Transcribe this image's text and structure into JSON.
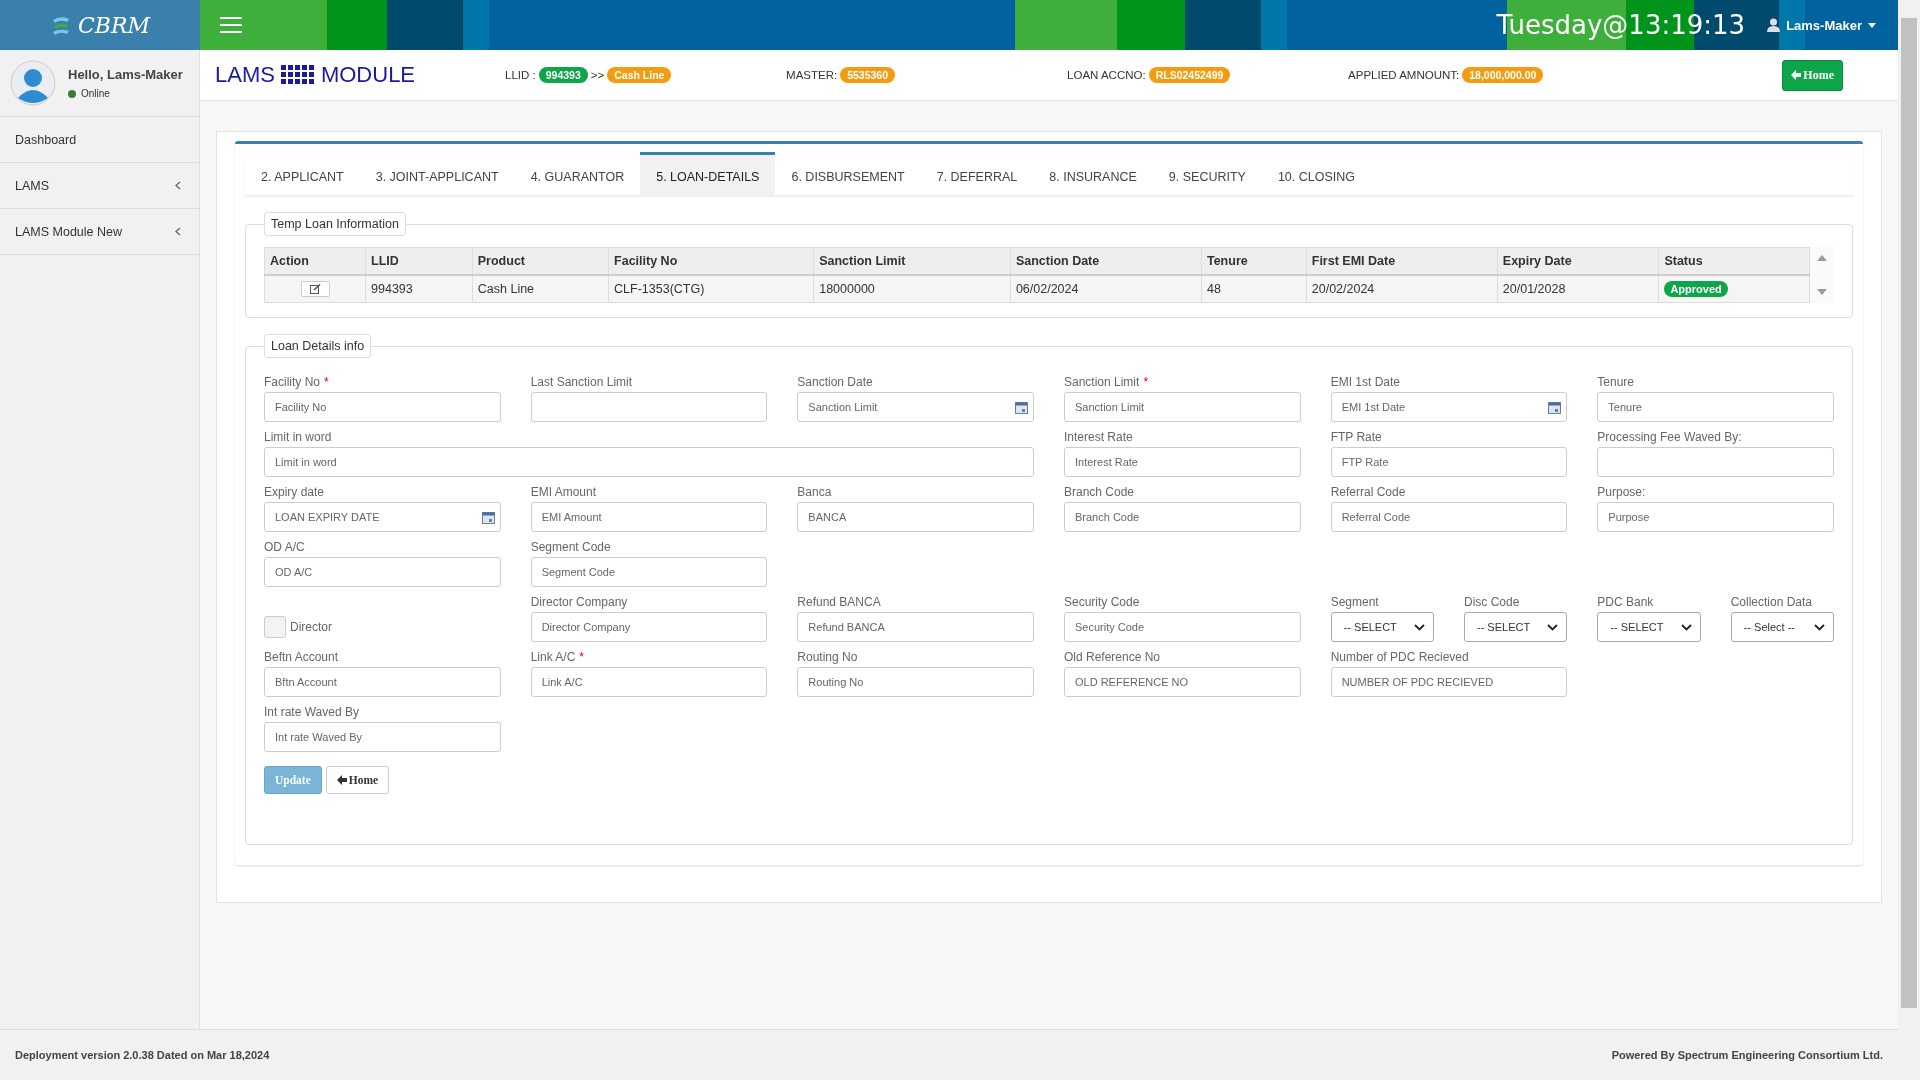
{
  "topbar": {
    "logo": "CBRM",
    "clock": "Tuesday@13:19:13",
    "user": "Lams-Maker"
  },
  "sidebar": {
    "greeting": "Hello, Lams-Maker",
    "status": "Online",
    "items": [
      {
        "label": "Dashboard",
        "expandable": false
      },
      {
        "label": "LAMS",
        "expandable": true
      },
      {
        "label": "LAMS Module New",
        "expandable": true
      }
    ]
  },
  "header": {
    "title_left": "LAMS",
    "title_right": "MODULE",
    "fields": [
      {
        "label": "LLID :",
        "badges": [
          {
            "text": "994393",
            "color": "#0fa54a"
          },
          {
            "text": "Cash Line",
            "color": "#f39c12"
          }
        ],
        "separator": ">>"
      },
      {
        "label": "MASTER:",
        "badges": [
          {
            "text": "5535360",
            "color": "#f39c12"
          }
        ]
      },
      {
        "label": "LOAN ACCNO:",
        "badges": [
          {
            "text": "RLS02452499",
            "color": "#f39c12"
          }
        ]
      },
      {
        "label": "APPLIED AMNOUNT:",
        "badges": [
          {
            "text": "18,000,000.00",
            "color": "#f39c12"
          }
        ]
      }
    ],
    "home_button": "Home"
  },
  "tabs": [
    {
      "label": "2. APPLICANT",
      "selected": false
    },
    {
      "label": "3. JOINT-APPLICANT",
      "selected": false
    },
    {
      "label": "4. GUARANTOR",
      "selected": false
    },
    {
      "label": "5. LOAN-DETAILS",
      "selected": true
    },
    {
      "label": "6. DISBURSEMENT",
      "selected": false
    },
    {
      "label": "7. DEFERRAL",
      "selected": false
    },
    {
      "label": "8. INSURANCE",
      "selected": false
    },
    {
      "label": "9. SECURITY",
      "selected": false
    },
    {
      "label": "10. CLOSING",
      "selected": false
    }
  ],
  "temp_loan": {
    "legend": "Temp Loan Information",
    "columns": [
      "Action",
      "LLID",
      "Product",
      "Facility No",
      "Sanction Limit",
      "Sanction Date",
      "Tenure",
      "First EMI Date",
      "Expiry Date",
      "Status"
    ],
    "rows": [
      {
        "cells": [
          "",
          "994393",
          "Cash Line",
          "CLF-1353(CTG)",
          "18000000",
          "06/02/2024",
          "48",
          "20/02/2024",
          "20/01/2028"
        ],
        "status": "Approved"
      }
    ]
  },
  "loan_details": {
    "legend": "Loan Details info",
    "rows": [
      [
        {
          "kind": "text",
          "label": "Facility No",
          "marker": "*",
          "placeholder": "Facility No"
        },
        {
          "kind": "text",
          "label": "Last Sanction Limit"
        },
        {
          "kind": "date",
          "label": "Sanction Date",
          "placeholder": "Sanction Limit"
        },
        {
          "kind": "text",
          "label": "Sanction Limit",
          "marker": "*",
          "placeholder": "Sanction Limit"
        },
        {
          "kind": "date",
          "label": "EMI 1st Date",
          "placeholder": "EMI 1st Date"
        },
        {
          "kind": "text",
          "label": "Tenure",
          "placeholder": "Tenure"
        }
      ],
      [
        {
          "kind": "wide",
          "label": "Limit in word",
          "placeholder": "Limit in word"
        },
        "",
        "",
        {
          "kind": "text",
          "label": "Interest Rate",
          "placeholder": "Interest Rate"
        },
        {
          "kind": "text",
          "label": "FTP Rate",
          "placeholder": "FTP Rate"
        },
        {
          "kind": "text",
          "label": "Processing Fee Waved By:"
        }
      ],
      [
        {
          "kind": "date",
          "label": "Expiry date",
          "placeholder": "LOAN EXPIRY DATE"
        },
        {
          "kind": "text",
          "label": "EMI Amount",
          "placeholder": "EMI Amount"
        },
        {
          "kind": "text",
          "label": "Banca",
          "placeholder": "BANCA"
        },
        {
          "kind": "text",
          "label": "Branch Code",
          "placeholder": "Branch Code"
        },
        {
          "kind": "text",
          "label": "Referral Code",
          "placeholder": "Referral Code"
        },
        {
          "kind": "text",
          "label": "Purpose:",
          "placeholder": "Purpose"
        }
      ],
      [
        {
          "kind": "text",
          "label": "OD A/C",
          "placeholder": "OD A/C"
        },
        {
          "kind": "text",
          "label": "Segment Code",
          "placeholder": "Segment Code"
        }
      ],
      [
        {
          "kind": "checkbox",
          "label": "Director",
          "checked": false
        },
        {
          "kind": "text",
          "label": "Director Company",
          "placeholder": "Director Company"
        },
        {
          "kind": "text",
          "label": "Refund BANCA",
          "placeholder": "Refund BANCA"
        },
        {
          "kind": "text",
          "label": "Security Code",
          "placeholder": "Security Code"
        },
        {
          "kind": "selects",
          "selects": [
            {
              "label": "Segment",
              "value": "-- SELECT"
            },
            {
              "label": "Disc Code",
              "value": "-- SELECT"
            }
          ]
        },
        {
          "kind": "selects",
          "selects": [
            {
              "label": "PDC Bank",
              "value": "-- SELECT"
            },
            {
              "label": "Collection Data",
              "value": "-- Select --"
            }
          ]
        }
      ],
      [
        {
          "kind": "text",
          "label": "Beftn Account",
          "placeholder": "Bftn Account"
        },
        {
          "kind": "text",
          "label": "Link A/C",
          "marker": "*",
          "placeholder": "Link A/C"
        },
        {
          "kind": "text",
          "label": "Routing No",
          "placeholder": "Routing No"
        },
        {
          "kind": "text",
          "label": "Old Reference No",
          "placeholder": "OLD REFERENCE NO"
        },
        {
          "kind": "text",
          "label": "Number of PDC Recieved",
          "placeholder": "NUMBER OF PDC RECIEVED"
        }
      ],
      [
        {
          "kind": "text",
          "label": "Int rate Waved By",
          "placeholder": "Int rate Waved By"
        }
      ]
    ],
    "update_button": "Update",
    "home_button": "Home"
  },
  "footer": {
    "left": "Deployment version 2.0.38 Dated on Mar 18,2024",
    "right": "Powered By Spectrum Engineering Consortium Ltd."
  }
}
